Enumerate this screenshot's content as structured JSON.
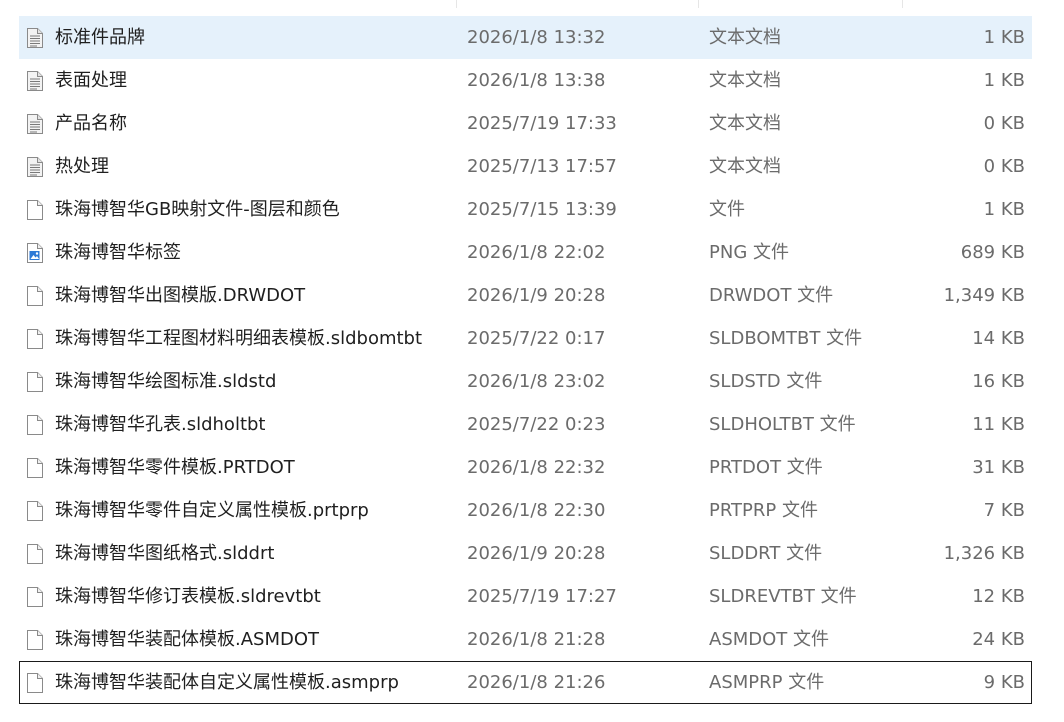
{
  "files": [
    {
      "name": "标准件品牌",
      "date": "2026/1/8 13:32",
      "type": "文本文档",
      "size": "1 KB",
      "icon": "text-document-icon",
      "state": "selected"
    },
    {
      "name": "表面处理",
      "date": "2026/1/8 13:38",
      "type": "文本文档",
      "size": "1 KB",
      "icon": "text-document-icon",
      "state": ""
    },
    {
      "name": "产品名称",
      "date": "2025/7/19 17:33",
      "type": "文本文档",
      "size": "0 KB",
      "icon": "text-document-icon",
      "state": ""
    },
    {
      "name": "热处理",
      "date": "2025/7/13 17:57",
      "type": "文本文档",
      "size": "0 KB",
      "icon": "text-document-icon",
      "state": ""
    },
    {
      "name": "珠海博智华GB映射文件-图层和颜色",
      "date": "2025/7/15 13:39",
      "type": "文件",
      "size": "1 KB",
      "icon": "blank-file-icon",
      "state": ""
    },
    {
      "name": "珠海博智华标签",
      "date": "2026/1/8 22:02",
      "type": "PNG 文件",
      "size": "689 KB",
      "icon": "image-file-icon",
      "state": ""
    },
    {
      "name": "珠海博智华出图模版.DRWDOT",
      "date": "2026/1/9 20:28",
      "type": "DRWDOT 文件",
      "size": "1,349 KB",
      "icon": "blank-file-icon",
      "state": ""
    },
    {
      "name": "珠海博智华工程图材料明细表模板.sldbomtbt",
      "date": "2025/7/22 0:17",
      "type": "SLDBOMTBT 文件",
      "size": "14 KB",
      "icon": "blank-file-icon",
      "state": ""
    },
    {
      "name": "珠海博智华绘图标准.sldstd",
      "date": "2026/1/8 23:02",
      "type": "SLDSTD 文件",
      "size": "16 KB",
      "icon": "blank-file-icon",
      "state": ""
    },
    {
      "name": "珠海博智华孔表.sldholtbt",
      "date": "2025/7/22 0:23",
      "type": "SLDHOLTBT 文件",
      "size": "11 KB",
      "icon": "blank-file-icon",
      "state": ""
    },
    {
      "name": "珠海博智华零件模板.PRTDOT",
      "date": "2026/1/8 22:32",
      "type": "PRTDOT 文件",
      "size": "31 KB",
      "icon": "blank-file-icon",
      "state": ""
    },
    {
      "name": "珠海博智华零件自定义属性模板.prtprp",
      "date": "2026/1/8 22:30",
      "type": "PRTPRP 文件",
      "size": "7 KB",
      "icon": "blank-file-icon",
      "state": ""
    },
    {
      "name": "珠海博智华图纸格式.slddrt",
      "date": "2026/1/9 20:28",
      "type": "SLDDRT 文件",
      "size": "1,326 KB",
      "icon": "blank-file-icon",
      "state": ""
    },
    {
      "name": "珠海博智华修订表模板.sldrevtbt",
      "date": "2025/7/19 17:27",
      "type": "SLDREVTBT 文件",
      "size": "12 KB",
      "icon": "blank-file-icon",
      "state": ""
    },
    {
      "name": "珠海博智华装配体模板.ASMDOT",
      "date": "2026/1/8 21:28",
      "type": "ASMDOT 文件",
      "size": "24 KB",
      "icon": "blank-file-icon",
      "state": ""
    },
    {
      "name": "珠海博智华装配体自定义属性模板.asmprp",
      "date": "2026/1/8 21:26",
      "type": "ASMPRP 文件",
      "size": "9 KB",
      "icon": "blank-file-icon",
      "state": "focused"
    }
  ],
  "colors": {
    "selected_bg": "#e5f1fb",
    "focus_border": "#1a1a1a",
    "secondary_text": "#6b6b6b",
    "image_icon_blue": "#2f7ad6"
  }
}
